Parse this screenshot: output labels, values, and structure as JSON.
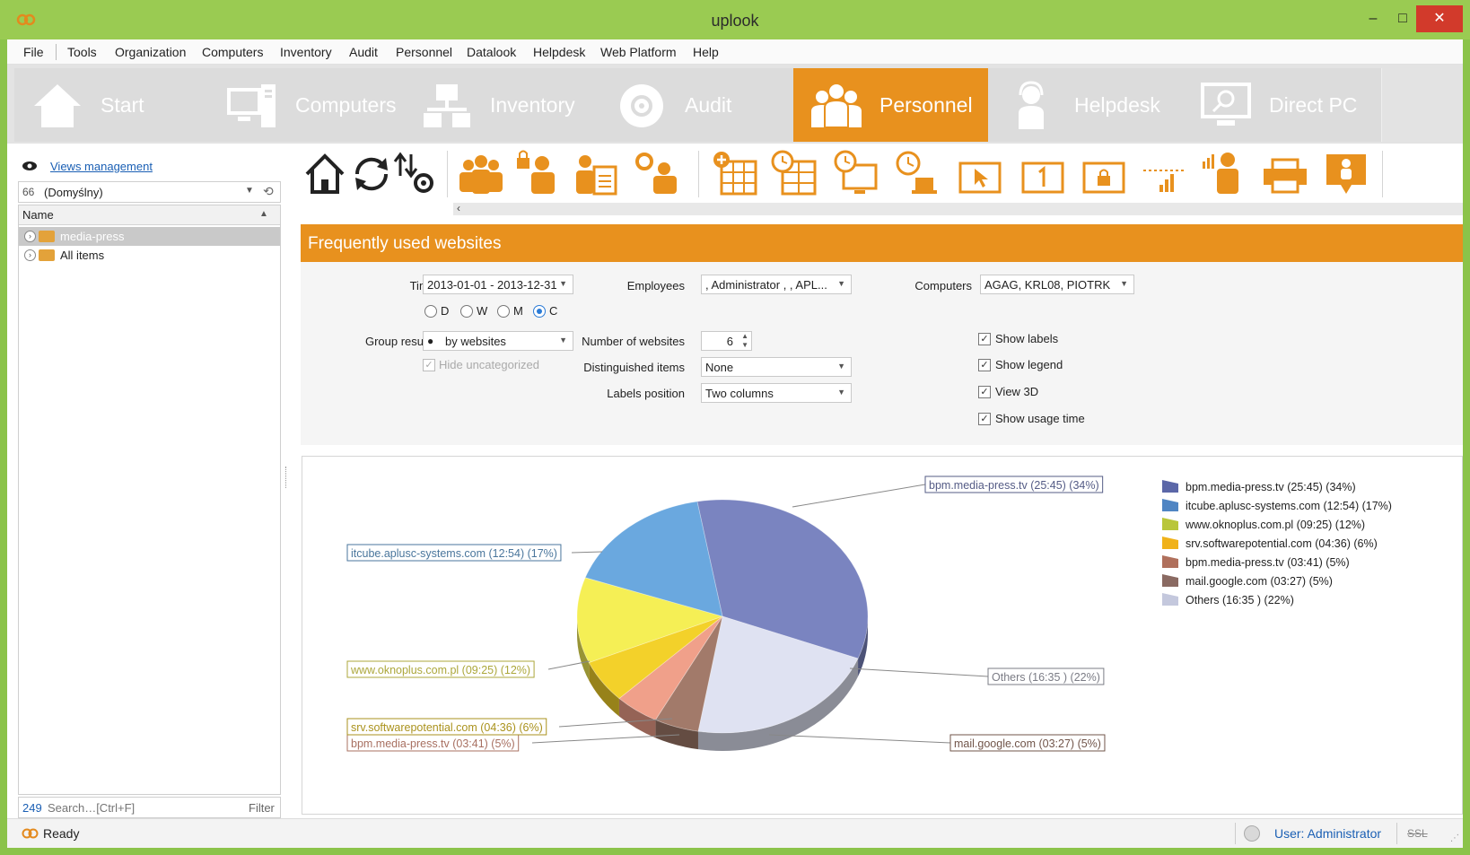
{
  "window": {
    "title": "uplook",
    "minimize": "–",
    "maximize": "□",
    "close": "✕"
  },
  "menu": [
    "File",
    "Tools",
    "Organization",
    "Computers",
    "Inventory",
    "Audit",
    "Personnel",
    "Datalook",
    "Helpdesk",
    "Web Platform",
    "Help"
  ],
  "modules": [
    {
      "label": "Start",
      "icon": "home-icon",
      "active": false
    },
    {
      "label": "Computers",
      "icon": "computers-icon",
      "active": false
    },
    {
      "label": "Inventory",
      "icon": "inventory-icon",
      "active": false
    },
    {
      "label": "Audit",
      "icon": "audit-icon",
      "active": false
    },
    {
      "label": "Personnel",
      "icon": "personnel-icon",
      "active": true
    },
    {
      "label": "Helpdesk",
      "icon": "helpdesk-icon",
      "active": false
    },
    {
      "label": "Direct PC",
      "icon": "direct-pc-icon",
      "active": false
    }
  ],
  "left_panel": {
    "views_link": "Views management",
    "view_select": "(Domyślny)",
    "tree_header": "Name",
    "tree_items": [
      {
        "label": "media-press",
        "selected": true
      },
      {
        "label": "All items",
        "selected": false
      }
    ],
    "search_count": "249",
    "search_placeholder": "Search…[Ctrl+F]",
    "filter_label": "Filter"
  },
  "toolbar_icons": [
    "home-icon",
    "refresh-icon",
    "sort-settings-icon",
    "group-icon",
    "user-lock-icon",
    "user-document-icon",
    "user-settings-icon",
    "add-table-icon",
    "clock-table-icon",
    "clock-monitor-icon",
    "clock-cup-icon",
    "cursor-window-icon",
    "number-window-icon",
    "lock-window-icon",
    "signal-bars-icon",
    "user-chart-icon",
    "printer-icon",
    "user-alert-icon"
  ],
  "report": {
    "title": "Frequently used websites",
    "time_label": "Time",
    "time_value": "2013-01-01 - 2013-12-31",
    "period_options": [
      {
        "label": "D",
        "selected": false
      },
      {
        "label": "W",
        "selected": false
      },
      {
        "label": "M",
        "selected": false
      },
      {
        "label": "C",
        "selected": true
      }
    ],
    "group_label": "Group results",
    "group_value": "by websites",
    "hide_uncategorized": "Hide uncategorized",
    "employees_label": "Employees",
    "employees_value": ", Administrator , , APL...",
    "websites_count_label": "Number of websites",
    "websites_count_value": "6",
    "distinguished_label": "Distinguished items",
    "distinguished_value": "None",
    "labels_position_label": "Labels position",
    "labels_position_value": "Two columns",
    "computers_label": "Computers",
    "computers_value": "AGAG, KRL08, PIOTRK",
    "checks": [
      {
        "label": "Show labels",
        "checked": true
      },
      {
        "label": "Show legend",
        "checked": true
      },
      {
        "label": "View 3D",
        "checked": true
      },
      {
        "label": "Show usage time",
        "checked": true
      }
    ]
  },
  "chart_data": {
    "type": "pie",
    "title": "",
    "view_3d": true,
    "legend_position": "top-right",
    "labels_position": "two columns",
    "slices": [
      {
        "label": "bpm.media-press.tv (25:45) (34%)",
        "name": "bpm.media-press.tv",
        "time": "25:45",
        "value": 34,
        "color": "#7a84c0"
      },
      {
        "label": "Others (16:35 ) (22%)",
        "name": "Others",
        "time": "16:35",
        "value": 22,
        "color": "#dfe2f2"
      },
      {
        "label": "mail.google.com (03:27) (5%)",
        "name": "mail.google.com",
        "time": "03:27",
        "value": 5,
        "color": "#a27a6a"
      },
      {
        "label": "bpm.media-press.tv (03:41) (5%)",
        "name": "bpm.media-press.tv",
        "time": "03:41",
        "value": 5,
        "color": "#f0a08a"
      },
      {
        "label": "srv.softwarepotential.com (04:36) (6%)",
        "name": "srv.softwarepotential.com",
        "time": "04:36",
        "value": 6,
        "color": "#f3d12a"
      },
      {
        "label": "www.oknoplus.com.pl (09:25) (12%)",
        "name": "www.oknoplus.com.pl",
        "time": "09:25",
        "value": 12,
        "color": "#f5ef55"
      },
      {
        "label": "itcube.aplusc-systems.com (12:54) (17%)",
        "name": "itcube.aplusc-systems.com",
        "time": "12:54",
        "value": 17,
        "color": "#6aa8df"
      }
    ],
    "legend": [
      {
        "label": "bpm.media-press.tv (25:45) (34%)",
        "color": "#5b67a8"
      },
      {
        "label": "itcube.aplusc-systems.com (12:54) (17%)",
        "color": "#4f85c3"
      },
      {
        "label": "www.oknoplus.com.pl (09:25) (12%)",
        "color": "#b9c63a"
      },
      {
        "label": "srv.softwarepotential.com (04:36) (6%)",
        "color": "#f0b21a"
      },
      {
        "label": "bpm.media-press.tv (03:41) (5%)",
        "color": "#b0705c"
      },
      {
        "label": "mail.google.com (03:27) (5%)",
        "color": "#8a6a62"
      },
      {
        "label": "Others (16:35 ) (22%)",
        "color": "#c4c8dd"
      }
    ]
  },
  "status": {
    "text": "Ready",
    "user": "User: Administrator",
    "ssl": "SSL"
  }
}
